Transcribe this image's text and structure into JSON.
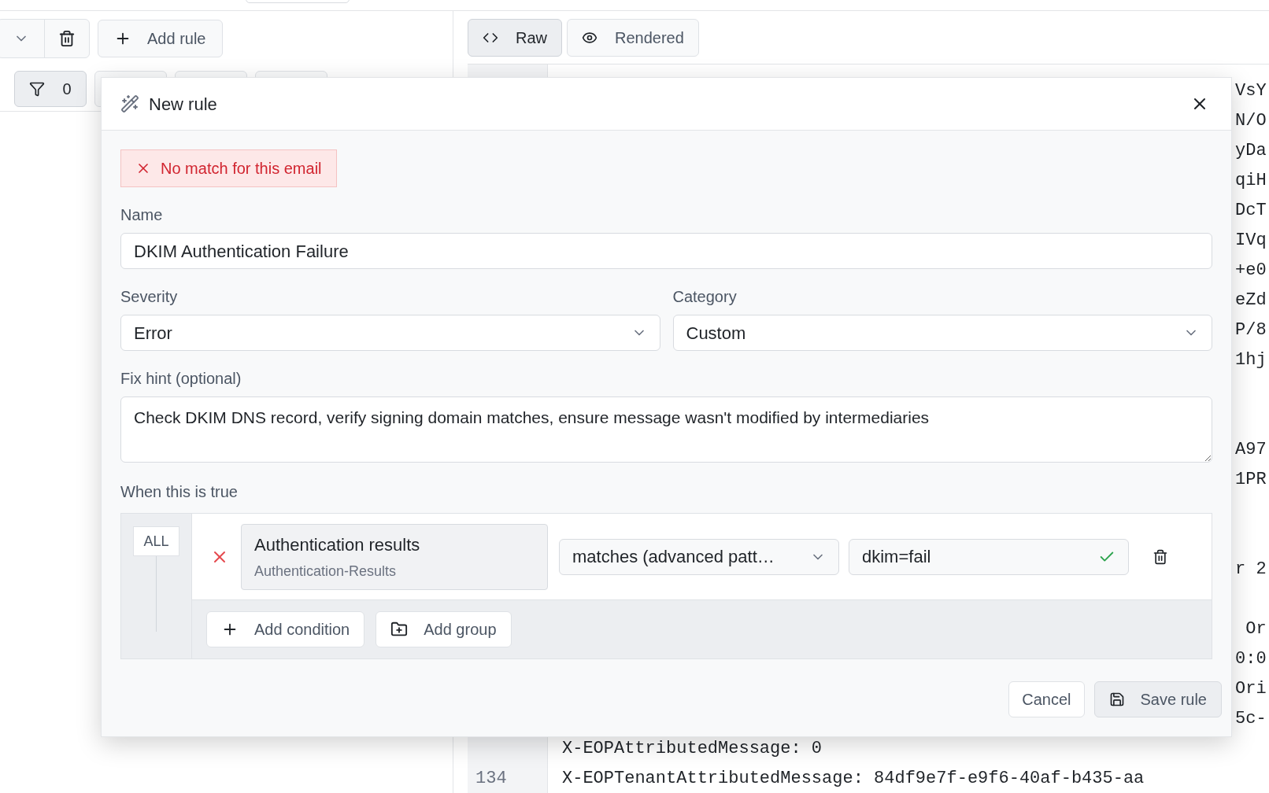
{
  "left_toolbar": {
    "add_button": {
      "label": "Add rule"
    },
    "filter": {
      "count": "0"
    }
  },
  "viewer_tabs": [
    {
      "label": "Raw",
      "selected": true,
      "kind": "code"
    },
    {
      "label": "Rendered",
      "selected": false,
      "kind": "eye"
    }
  ],
  "code_lines": [
    {
      "kind": "tail",
      "text": "VsY"
    },
    {
      "kind": "tail",
      "text": "N/O"
    },
    {
      "kind": "tail",
      "text": "yDa"
    },
    {
      "kind": "tail",
      "text": "qiH"
    },
    {
      "kind": "tail",
      "text": "DcT"
    },
    {
      "kind": "tail",
      "text": "IVq"
    },
    {
      "kind": "tail",
      "text": "+e0"
    },
    {
      "kind": "tail",
      "text": "eZd"
    },
    {
      "kind": "tail",
      "text": "P/8"
    },
    {
      "kind": "tail",
      "text": "1hj"
    },
    {
      "kind": "blank"
    },
    {
      "kind": "blank"
    },
    {
      "kind": "tail",
      "text": "A97"
    },
    {
      "kind": "tail",
      "text": "1PR"
    },
    {
      "kind": "blank"
    },
    {
      "kind": "blank"
    },
    {
      "kind": "tail",
      "text": "r 2"
    },
    {
      "kind": "blank"
    },
    {
      "kind": "tail",
      "text": " Or"
    },
    {
      "kind": "tail",
      "text": "0:0"
    },
    {
      "kind": "tail",
      "text": "Ori"
    },
    {
      "kind": "tail",
      "text": "5c-"
    },
    {
      "kind": "full",
      "text": "X-EOPAttributedMessage: 0"
    },
    {
      "kind": "full",
      "number": "134",
      "text": "X-EOPTenantAttributedMessage: 84df9e7f-e9f6-40af-b435-aa"
    }
  ],
  "dialog": {
    "title": "New rule",
    "status": {
      "matched": false,
      "text": "No match for this email"
    },
    "name": {
      "label": "Name",
      "value": "DKIM Authentication Failure"
    },
    "severity": {
      "label": "Severity",
      "value": "Error"
    },
    "category": {
      "label": "Category",
      "value": "Custom"
    },
    "fix_hint": {
      "label": "Fix hint (optional)",
      "value": "Check DKIM DNS record, verify signing domain matches, ensure message wasn't modified by intermediaries"
    },
    "conditions": {
      "label": "When this is true",
      "combinator": "ALL",
      "items": [
        {
          "field": "Authentication results",
          "header": "Authentication-Results",
          "operator": "matches (advanced patt…",
          "value": "dkim=fail",
          "valid": true
        }
      ],
      "add_condition": "Add condition",
      "add_group": "Add group"
    },
    "cancel": "Cancel",
    "save": "Save rule"
  }
}
